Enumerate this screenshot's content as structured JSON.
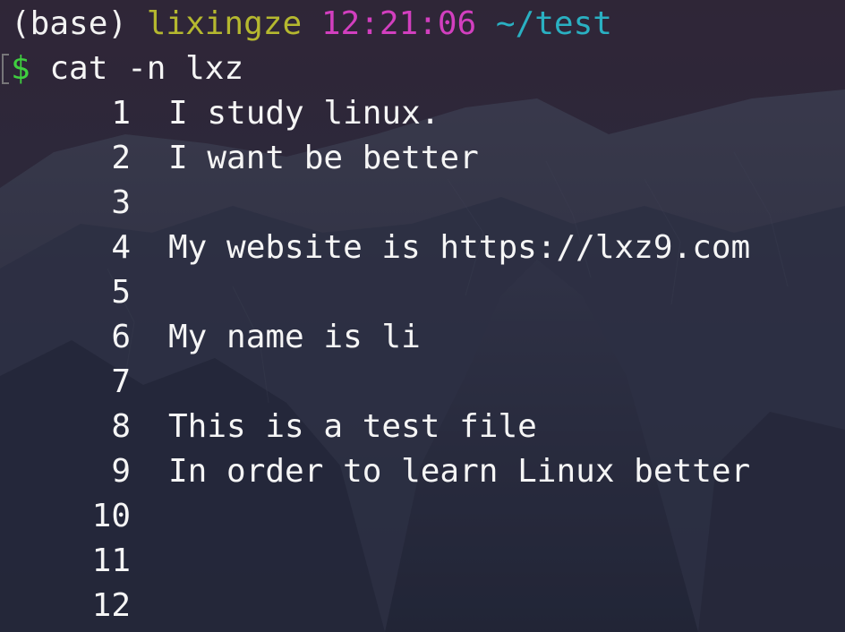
{
  "prompt": {
    "env": "(base)",
    "user": "lixingze",
    "time": "12:21:06",
    "path": "~/test"
  },
  "command": {
    "symbol": "$",
    "text": "cat -n lxz"
  },
  "output": [
    {
      "num": "1",
      "text": "I study linux."
    },
    {
      "num": "2",
      "text": "I want be better"
    },
    {
      "num": "3",
      "text": ""
    },
    {
      "num": "4",
      "text": "My website is https://lxz9.com"
    },
    {
      "num": "5",
      "text": ""
    },
    {
      "num": "6",
      "text": "My name is li"
    },
    {
      "num": "7",
      "text": ""
    },
    {
      "num": "8",
      "text": "This is a test file"
    },
    {
      "num": "9",
      "text": "In order to learn Linux better"
    },
    {
      "num": "10",
      "text": ""
    },
    {
      "num": "11",
      "text": ""
    },
    {
      "num": "12",
      "text": ""
    }
  ],
  "colors": {
    "user": "#b5b82f",
    "time": "#d23fbf",
    "path": "#2ab0c2",
    "dollar": "#3fcf3f",
    "text": "#f5f5f5"
  }
}
